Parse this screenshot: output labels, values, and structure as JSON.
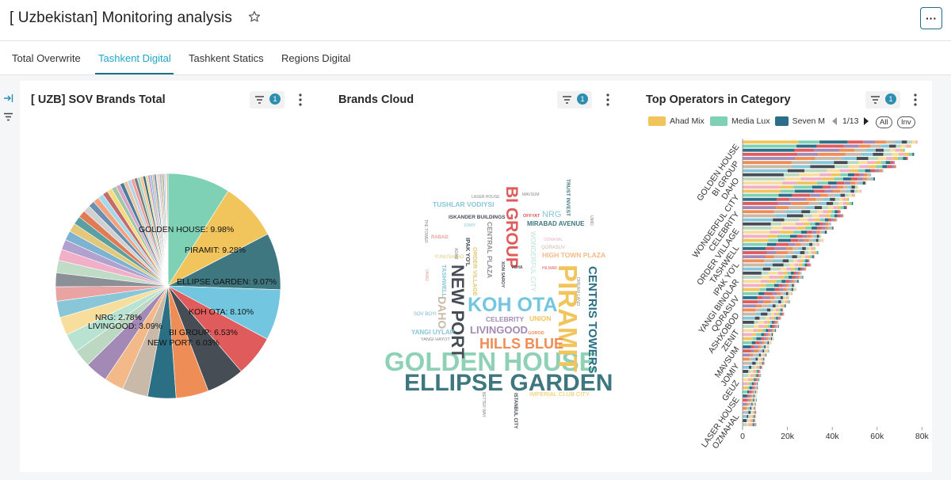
{
  "header": {
    "title": "[ Uzbekistan] Monitoring analysis",
    "star_icon": "star-icon",
    "more_label": "···"
  },
  "tabs": [
    {
      "label": "Total Overwrite",
      "active": false
    },
    {
      "label": "Tashkent Digital",
      "active": true
    },
    {
      "label": "Tashkent Statics",
      "active": false
    },
    {
      "label": "Regions Digital",
      "active": false
    }
  ],
  "panels": {
    "pie": {
      "title": "[ UZB] SOV Brands Total",
      "filter_count": "1"
    },
    "cloud": {
      "title": "Brands Cloud",
      "filter_count": "1"
    },
    "bars": {
      "title": "Top Operators in Category",
      "filter_count": "1",
      "legend": [
        {
          "label": "Ahad Mix",
          "color": "#f2c45c"
        },
        {
          "label": "Media Lux",
          "color": "#7fd1b5"
        },
        {
          "label": "Seven M",
          "color": "#2d6f88"
        }
      ],
      "pager": "1/13",
      "all_label": "All",
      "inv_label": "Inv"
    }
  },
  "chart_data": [
    {
      "type": "pie",
      "labeled_slices": [
        {
          "label": "GOLDEN HOUSE: 9.98%",
          "value": 9.98,
          "color": "#7fd1b5"
        },
        {
          "label": "PIRAMIT: 9.28%",
          "value": 9.28,
          "color": "#f2c45c"
        },
        {
          "label": "ELLIPSE GARDEN: 9.07%",
          "value": 9.07,
          "color": "#3f7780"
        },
        {
          "label": "KOH OTA: 8.10%",
          "value": 8.1,
          "color": "#73c6e0"
        },
        {
          "label": "BI GROUP: 6.53%",
          "value": 6.53,
          "color": "#e05b5b"
        },
        {
          "label": "NEW PORT: 6.03%",
          "value": 6.03,
          "color": "#474d55"
        },
        {
          "label": "NRG: 2.78%",
          "value": 2.78,
          "color": "#bcd8c2"
        },
        {
          "label": "LIVINGOOD: 3.09%",
          "value": 3.09,
          "color": "#f4b988"
        }
      ],
      "other_slice_values": [
        5.2,
        4.5,
        4.1,
        3.6,
        3.0,
        2.9,
        2.6,
        2.3,
        2.2,
        2.0,
        1.8,
        1.6,
        1.5,
        1.4,
        1.3,
        1.2,
        1.1,
        1.0,
        0.95,
        0.9,
        0.85,
        0.8,
        0.75,
        0.7,
        0.66,
        0.62,
        0.58,
        0.54,
        0.5,
        0.47,
        0.44,
        0.41,
        0.38,
        0.36,
        0.34,
        0.32,
        0.3,
        0.28,
        0.26,
        0.25,
        0.24,
        0.23,
        0.22,
        0.21,
        0.2
      ],
      "other_slice_colors": [
        "#ef8d56",
        "#2b6f85",
        "#c9b9a8",
        "#a38ab6",
        "#b8e3d2",
        "#f7de9c",
        "#88c6d8",
        "#e9a3a3",
        "#8a9096",
        "#c0dcc7",
        "#f2b0c8",
        "#b0a1cf",
        "#7db3d0",
        "#e4c879",
        "#5aa0a2",
        "#e07b54",
        "#d0d0d0",
        "#6a8fb1",
        "#f1a27b",
        "#a6d7ea",
        "#c46b6b",
        "#f4dc7d",
        "#9fc7a8",
        "#d6a4c9",
        "#4c7c9b",
        "#e8c5a1",
        "#b4d3e8",
        "#f29c9c",
        "#7a7a7a",
        "#a7d6c0",
        "#f7c08a",
        "#3d6d86",
        "#e3e08c",
        "#c39ad2",
        "#8cc3d9",
        "#eab0a0",
        "#5d8aa8",
        "#d7e8b6",
        "#f1b7cc",
        "#9fb5c9",
        "#e0a86e",
        "#70b4b0",
        "#c7c7e6",
        "#f0d7b0",
        "#a9a9a9"
      ]
    },
    {
      "type": "other",
      "words": [
        {
          "text": "GOLDEN HOUSE",
          "color": "#8ed1b6"
        },
        {
          "text": "ELLIPSE GARDEN",
          "color": "#3f7780"
        },
        {
          "text": "KOH OTA",
          "color": "#73c6e0"
        },
        {
          "text": "PIRAMIT",
          "color": "#f2c45c"
        },
        {
          "text": "NEW PORT",
          "color": "#474d55"
        },
        {
          "text": "BI GROUP",
          "color": "#e05b5b"
        },
        {
          "text": "CENTRIS TOWERS",
          "color": "#2b6f85"
        },
        {
          "text": "HILLS BLUE",
          "color": "#ef8d56"
        },
        {
          "text": "LIVINGOOD",
          "color": "#a38ab6"
        },
        {
          "text": "DAHO",
          "color": "#c9b9a8"
        },
        {
          "text": "CELEBRITY",
          "color": "#a38ab6"
        },
        {
          "text": "UNION",
          "color": "#f2c45c"
        },
        {
          "text": "NRG",
          "color": "#88c6d8"
        },
        {
          "text": "MIRABAD AVENUE",
          "color": "#3f7780"
        },
        {
          "text": "HIGH TOWN PLAZA",
          "color": "#f4b988"
        },
        {
          "text": "TUSHLAR VODIYSI",
          "color": "#88c6d8"
        },
        {
          "text": "ISKANDER BUILDINGS",
          "color": "#474d55"
        },
        {
          "text": "IMPERIAL CLUB CITY",
          "color": "#f2c45c"
        },
        {
          "text": "ORDER VILLAGE",
          "color": "#e4c879"
        },
        {
          "text": "WONDERFUL CITY",
          "color": "#b8e3d2"
        },
        {
          "text": "CENTRAL PLAZA",
          "color": "#8a9096"
        },
        {
          "text": "TASHWELL",
          "color": "#88c6d8"
        },
        {
          "text": "IPAK YO'L",
          "color": "#474d55"
        },
        {
          "text": "YANGI UYLAR",
          "color": "#88c6d8"
        },
        {
          "text": "TRUST INVEST",
          "color": "#3f7780"
        },
        {
          "text": "ISTANBUL CITY",
          "color": "#474d55"
        },
        {
          "text": "XON SAROY",
          "color": "#474d55"
        },
        {
          "text": "DREAM LAND",
          "color": "#888888"
        },
        {
          "text": "QORASUV",
          "color": "#c9b9a8"
        },
        {
          "text": "SOV BOYI",
          "color": "#7db3d0"
        },
        {
          "text": "YANGI HAYOT",
          "color": "#888888"
        },
        {
          "text": "RABAD",
          "color": "#e9a3a3"
        },
        {
          "text": "YUNUSABAD",
          "color": "#e4c879"
        },
        {
          "text": "LASER HOUSE",
          "color": "#888888"
        },
        {
          "text": "OFFYAT",
          "color": "#e05b5b"
        },
        {
          "text": "MAVSUM",
          "color": "#888888"
        },
        {
          "text": "JOMIY",
          "color": "#88c6d8"
        },
        {
          "text": "OZMAHAL",
          "color": "#f2b0c8"
        },
        {
          "text": "VOHA",
          "color": "#474d55"
        },
        {
          "text": "GOROD",
          "color": "#ef8d56"
        },
        {
          "text": "HILMAR",
          "color": "#e05b5b"
        },
        {
          "text": "BETTER WAY",
          "color": "#888888"
        },
        {
          "text": "THE TOWER",
          "color": "#888888"
        },
        {
          "text": "ADAM",
          "color": "#888888"
        },
        {
          "text": "OMAD",
          "color": "#e9a3a3"
        },
        {
          "text": "UMID",
          "color": "#888888"
        }
      ]
    },
    {
      "type": "bar",
      "orientation": "horizontal",
      "stacked": true,
      "categories": [
        "GOLDEN HOUSE",
        "BI GROUP",
        "DAHO",
        "WONDERFUL CITY",
        "CELEBRITY",
        "ORDER VILLAGE",
        "TASHWELL",
        "IPAK YO'L",
        "YANGI BINOLAR",
        "QORASUV",
        "ASHXOBOD",
        "ZENIT",
        "MAVSUM",
        "JOMIY",
        "GEUZ",
        "LASER HOUSE",
        "OZMAHAL"
      ],
      "totals": [
        78000,
        76000,
        61000,
        53000,
        48000,
        42000,
        36000,
        33000,
        28000,
        24000,
        20000,
        17000,
        14000,
        11000,
        8500,
        7000,
        6000
      ],
      "series_colors": [
        "#f2c45c",
        "#7fd1b5",
        "#2d6f88",
        "#e05b5b",
        "#a38ab6",
        "#ef8d56",
        "#c9b9a8",
        "#88c6d8",
        "#474d55",
        "#bcd8c2",
        "#f7de9c",
        "#f2b0c8"
      ],
      "xticks": [
        "0",
        "20k",
        "40k",
        "60k",
        "80k"
      ],
      "xlim": [
        0,
        82000
      ]
    }
  ]
}
